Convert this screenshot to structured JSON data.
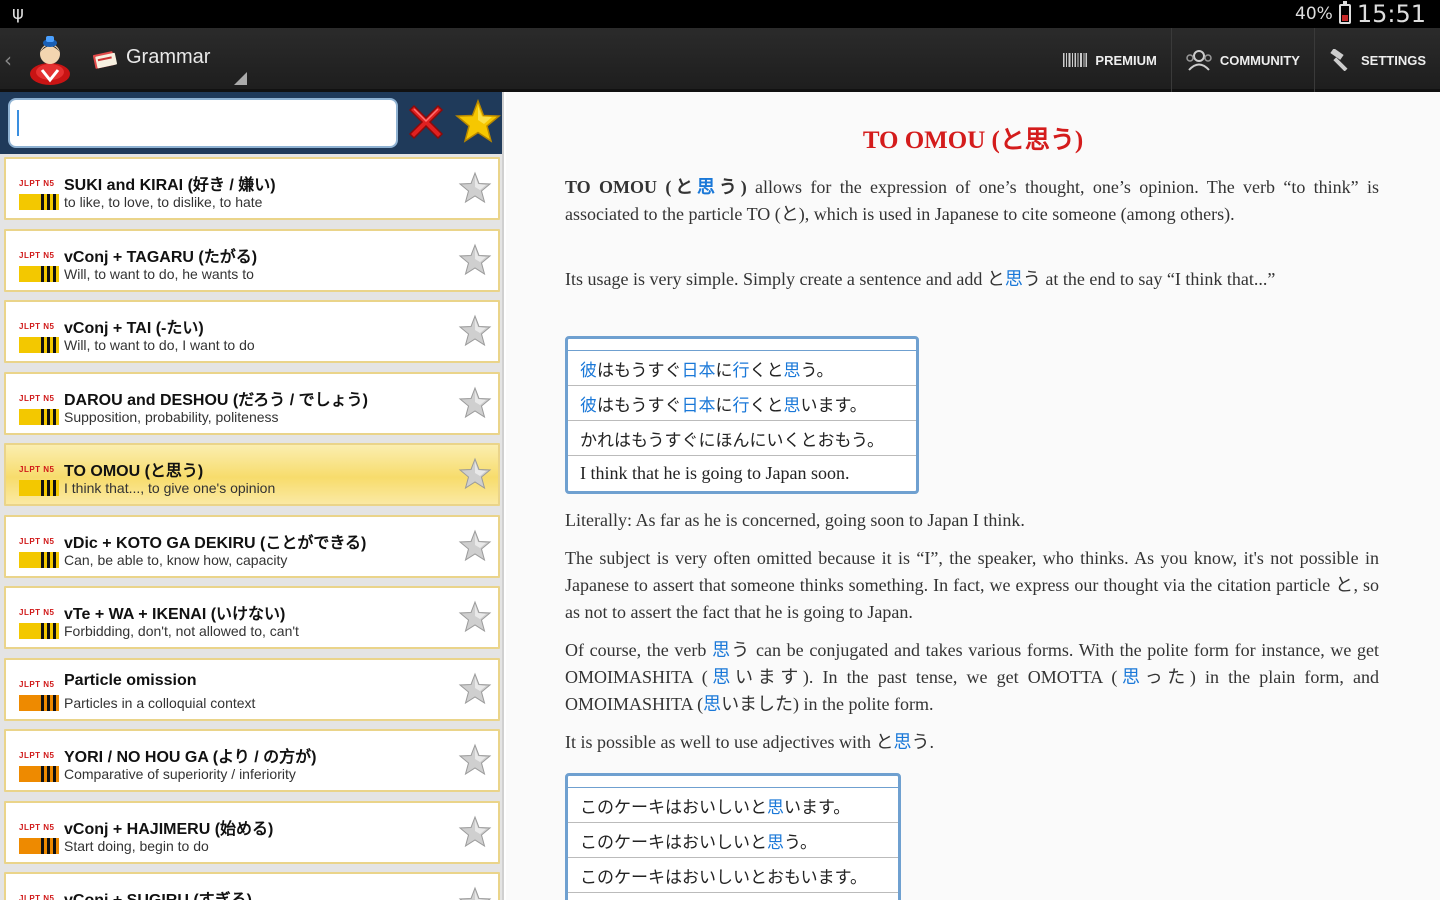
{
  "status_bar": {
    "battery": "40%",
    "time": "15:51",
    "usb_icon": "usb-icon"
  },
  "action_bar": {
    "section": "Grammar",
    "buttons": [
      {
        "label": "PREMIUM",
        "icon": "barcode-icon"
      },
      {
        "label": "COMMUNITY",
        "icon": "community-icon"
      },
      {
        "label": "SETTINGS",
        "icon": "settings-icon"
      }
    ]
  },
  "search": {
    "value": "",
    "clear_icon": "red-x-icon",
    "favorite_icon": "gold-star-icon"
  },
  "grammar_list": [
    {
      "jlpt": "JLPT N5",
      "title": "SUKI and KIRAI (好き / 嫌い)",
      "desc": "to like, to love, to dislike, to hate",
      "level_color": "#f3c800",
      "selected": false
    },
    {
      "jlpt": "JLPT N5",
      "title": "vConj + TAGARU (たがる)",
      "desc": "Will, to want to do, he wants to",
      "level_color": "#f3c800",
      "selected": false
    },
    {
      "jlpt": "JLPT N5",
      "title": "vConj + TAI (-たい)",
      "desc": "Will, to want to do, I want to do",
      "level_color": "#f3c800",
      "selected": false
    },
    {
      "jlpt": "JLPT N5",
      "title": "DAROU and DESHOU (だろう / でしょう)",
      "desc": "Supposition, probability, politeness",
      "level_color": "#f3c800",
      "selected": false
    },
    {
      "jlpt": "JLPT N5",
      "title": "TO OMOU (と思う)",
      "desc": "I think that..., to give one's opinion",
      "level_color": "#f3c800",
      "selected": true
    },
    {
      "jlpt": "JLPT N5",
      "title": "vDic + KOTO GA DEKIRU (ことができる)",
      "desc": "Can, be able to, know how, capacity",
      "level_color": "#f3c800",
      "selected": false
    },
    {
      "jlpt": "JLPT N5",
      "title": "vTe + WA + IKENAI (いけない)",
      "desc": "Forbidding, don't, not allowed to, can't",
      "level_color": "#f3c800",
      "selected": false
    },
    {
      "jlpt": "JLPT N5",
      "title": "Particle omission",
      "desc": "Particles in a colloquial context",
      "level_color": "#ee8a00",
      "selected": false
    },
    {
      "jlpt": "JLPT N5",
      "title": "YORI / NO HOU GA (より / の方が)",
      "desc": "Comparative of superiority / inferiority",
      "level_color": "#ee8a00",
      "selected": false
    },
    {
      "jlpt": "JLPT N5",
      "title": "vConj + HAJIMERU (始める)",
      "desc": "Start doing, begin to do",
      "level_color": "#ee8a00",
      "selected": false
    },
    {
      "jlpt": "JLPT N5",
      "title": "vConj + SUGIRU (すぎる)",
      "desc": "",
      "level_color": "#ee8a00",
      "selected": false
    }
  ],
  "article": {
    "title": "TO OMOU (と思う)",
    "p1": [
      {
        "t": "TO OMOU (と",
        "s": "b"
      },
      {
        "t": "思",
        "s": "bblue"
      },
      {
        "t": "う)",
        "s": "b"
      },
      {
        "t": " allows for the expression of one’s thought, one’s opinion. The verb “to think” is associated to the particle TO (と), which is used in Japanese to cite someone (among others).",
        "s": ""
      }
    ],
    "p2": [
      {
        "t": "Its usage is very simple. Simply create a sentence and add と",
        "s": ""
      },
      {
        "t": "思",
        "s": "blue"
      },
      {
        "t": "う at the end to say “I think that...”",
        "s": ""
      }
    ],
    "example1": [
      [
        {
          "t": "彼",
          "s": "blue"
        },
        {
          "t": "はもうすぐ",
          "s": ""
        },
        {
          "t": "日本",
          "s": "blue"
        },
        {
          "t": "に",
          "s": ""
        },
        {
          "t": "行",
          "s": "blue"
        },
        {
          "t": "くと",
          "s": ""
        },
        {
          "t": "思",
          "s": "blue"
        },
        {
          "t": "う。",
          "s": ""
        }
      ],
      [
        {
          "t": "彼",
          "s": "blue"
        },
        {
          "t": "はもうすぐ",
          "s": ""
        },
        {
          "t": "日本",
          "s": "blue"
        },
        {
          "t": "に",
          "s": ""
        },
        {
          "t": "行",
          "s": "blue"
        },
        {
          "t": "くと",
          "s": ""
        },
        {
          "t": "思",
          "s": "blue"
        },
        {
          "t": "います。",
          "s": ""
        }
      ],
      [
        {
          "t": "かれはもうすぐにほんにいくとおもう。",
          "s": ""
        }
      ],
      [
        {
          "t": "I think that he is going to Japan soon.",
          "s": ""
        }
      ]
    ],
    "p3": [
      {
        "t": "Literally: As far as he is concerned, going soon to Japan I think.",
        "s": ""
      }
    ],
    "p4": [
      {
        "t": "The subject is very often omitted because it is “I”, the speaker, who thinks. As you know, it's not possible in Japanese to assert that someone thinks something. In fact, we express our thought via the citation particle と, so as not to assert the fact that he is going to Japan.",
        "s": ""
      }
    ],
    "p5": [
      {
        "t": "Of course, the verb ",
        "s": ""
      },
      {
        "t": "思",
        "s": "blue"
      },
      {
        "t": "う can be conjugated and takes various forms. With the polite form for instance, we get OMOIMASHITA (",
        "s": ""
      },
      {
        "t": "思",
        "s": "blue"
      },
      {
        "t": "います). In the past tense, we get OMOTTA (",
        "s": ""
      },
      {
        "t": "思",
        "s": "blue"
      },
      {
        "t": "った) in the plain form, and OMOIMASHITA (",
        "s": ""
      },
      {
        "t": "思",
        "s": "blue"
      },
      {
        "t": "いました) in the polite form.",
        "s": ""
      }
    ],
    "p6": [
      {
        "t": "It is possible as well to use adjectives with と",
        "s": ""
      },
      {
        "t": "思",
        "s": "blue"
      },
      {
        "t": "う.",
        "s": ""
      }
    ],
    "example2": [
      [
        {
          "t": "このケーキはおいしいと",
          "s": ""
        },
        {
          "t": "思",
          "s": "blue"
        },
        {
          "t": "います。",
          "s": ""
        }
      ],
      [
        {
          "t": "このケーキはおいしいと",
          "s": ""
        },
        {
          "t": "思",
          "s": "blue"
        },
        {
          "t": "う。",
          "s": ""
        }
      ],
      [
        {
          "t": "このケーキはおいしいとおもいます。",
          "s": ""
        }
      ],
      [
        {
          "t": "",
          "s": ""
        }
      ]
    ]
  },
  "colors": {
    "accent_red": "#d41c1c",
    "kanji_blue": "#1a78d8",
    "selected_row": "#f7dc6c",
    "search_bar_bg": "#1f3a5a"
  }
}
